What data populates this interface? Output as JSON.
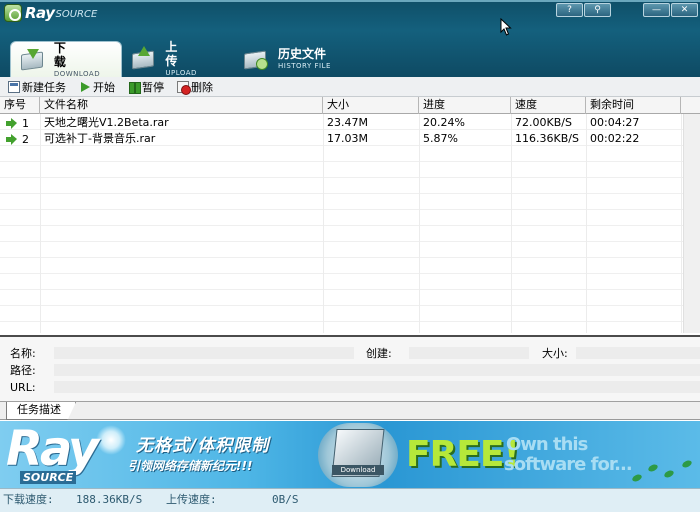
{
  "brand": {
    "main": "Ray",
    "sub": "SOURCE"
  },
  "window_buttons": {
    "help": "?",
    "settings": "⚲",
    "minimize": "—",
    "close": "✕"
  },
  "tabs": [
    {
      "cn": "下 载",
      "en": "DOWNLOAD",
      "active": true
    },
    {
      "cn": "上 传",
      "en": "UPLOAD",
      "active": false
    },
    {
      "cn": "历史文件",
      "en": "HISTORY FILE",
      "active": false
    }
  ],
  "toolbar": {
    "new_task": "新建任务",
    "start": "开始",
    "pause": "暂停",
    "delete": "删除"
  },
  "table": {
    "headers": [
      "序号",
      "文件名称",
      "大小",
      "进度",
      "速度",
      "剩余时间"
    ],
    "rows": [
      {
        "index": "1",
        "name": "天地之曙光V1.2Beta.rar",
        "size": "23.47M",
        "progress": "20.24%",
        "speed": "72.00KB/S",
        "remaining": "00:04:27"
      },
      {
        "index": "2",
        "name": "可选补丁-背景音乐.rar",
        "size": "17.03M",
        "progress": "5.87%",
        "speed": "116.36KB/S",
        "remaining": "00:02:22"
      }
    ]
  },
  "details": {
    "name_label": "名称:",
    "created_label": "创建:",
    "size_label": "大小:",
    "path_label": "路径:",
    "url_label": "URL:"
  },
  "desc_tab": "任务描述",
  "banner": {
    "logo": "Ray",
    "logo_sub": "SOURCE",
    "line1": "无格式/体积限制",
    "line2": "引领网络存储新纪元!!!",
    "box_label": "Download",
    "free": "FREE!",
    "own1": "Own this",
    "own2": "software for..."
  },
  "status": {
    "down_label": "下载速度:",
    "down_value": "188.36KB/S",
    "up_label": "上传速度:",
    "up_value": "0B/S"
  }
}
